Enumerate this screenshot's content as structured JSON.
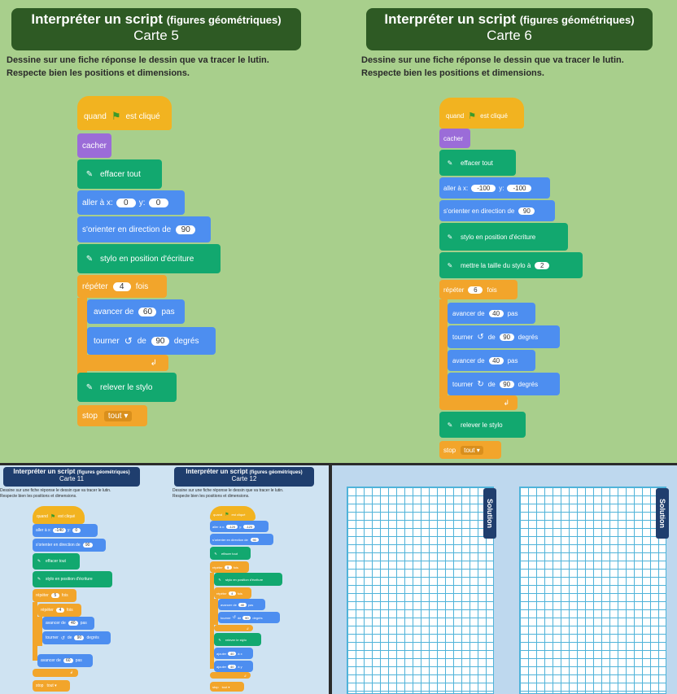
{
  "instructions": {
    "line1": "Dessine sur une fiche réponse le dessin que va tracer le lutin.",
    "line2": "Respecte bien les positions et dimensions."
  },
  "title": "Interpréter un script",
  "subtitle_paren": "(figures géométriques)",
  "card5": {
    "label": "Carte 5",
    "when": "quand",
    "clicked": "est cliqué",
    "hide": "cacher",
    "erase": "effacer tout",
    "goto": "aller à x:",
    "x": "0",
    "y_label": "y:",
    "y": "0",
    "dir": "s'orienter en direction de",
    "dir_val": "90",
    "pendown": "stylo en position d'écriture",
    "repeat": "répéter",
    "repeat_val": "4",
    "times": "fois",
    "move": "avancer de",
    "move_val": "60",
    "steps": "pas",
    "turn": "tourner",
    "turn_symbol": "↺",
    "de": "de",
    "turn_val": "90",
    "deg": "degrés",
    "penup": "relever le stylo",
    "stop": "stop",
    "stop_val": "tout ▾"
  },
  "card6": {
    "label": "Carte 6",
    "when": "quand",
    "clicked": "est cliqué",
    "hide": "cacher",
    "erase": "effacer tout",
    "goto": "aller à x:",
    "x": "-100",
    "y_label": "y:",
    "y": "-100",
    "dir": "s'orienter en direction de",
    "dir_val": "90",
    "pendown": "stylo en position d'écriture",
    "pensize": "mettre la taille du stylo à",
    "pensize_val": "2",
    "repeat": "répéter",
    "repeat_val": "6",
    "times": "fois",
    "move": "avancer de",
    "move_val": "40",
    "steps": "pas",
    "turn": "tourner",
    "turn_symbol_left": "↺",
    "turn_symbol_right": "↻",
    "de": "de",
    "turn_val": "90",
    "deg": "degrés",
    "penup": "relever le stylo",
    "stop": "stop",
    "stop_val": "tout ▾"
  },
  "card11": {
    "label": "Carte 11",
    "when": "quand",
    "clicked": "est cliqué",
    "goto": "aller à x:",
    "x": "-140",
    "y_label": "y:",
    "y": "0",
    "dir": "s'orienter en direction de",
    "dir_val": "90",
    "erase": "effacer tout",
    "pendown": "stylo en position d'écriture",
    "repeat": "répéter",
    "repeat_outer": "5",
    "repeat_inner": "4",
    "times": "fois",
    "move": "avancer de",
    "move_val": "40",
    "steps": "pas",
    "turn": "tourner",
    "turn_symbol": "↺",
    "de": "de",
    "turn_val": "90",
    "deg": "degrés",
    "move2_val": "60",
    "stop": "stop",
    "stop_val": "tout ▾"
  },
  "card12": {
    "label": "Carte 12",
    "when": "quand",
    "clicked": "est cliqué",
    "goto": "aller à x:",
    "x": "-120",
    "y_label": "y:",
    "y": "-120",
    "dir": "s'orienter en direction de",
    "dir_val": "90",
    "erase": "effacer tout",
    "repeat": "répéter",
    "repeat_outer": "5",
    "repeat_inner": "4",
    "times": "fois",
    "pendown": "stylo en position d'écriture",
    "move": "avancer de",
    "move_val": "40",
    "steps": "pas",
    "turn": "tourner",
    "turn_symbol": "↺",
    "de": "de",
    "turn_val": "90",
    "deg": "degrés",
    "penup": "relever le stylo",
    "addx": "ajouter",
    "addx_val": "40",
    "ax": "à x",
    "addy_val": "40",
    "ay": "à y",
    "stop": "stop",
    "stop_val": "tout ▾"
  },
  "solution_label": "Solution",
  "colors": {
    "events": "#f2b320",
    "looks": "#9b6cd8",
    "pen": "#12a86f",
    "motion": "#4d8ef0",
    "control": "#f2a52b",
    "banner_green": "#2e5a24",
    "banner_blue": "#1f3e6e",
    "grid_line": "#4fb3d9"
  }
}
